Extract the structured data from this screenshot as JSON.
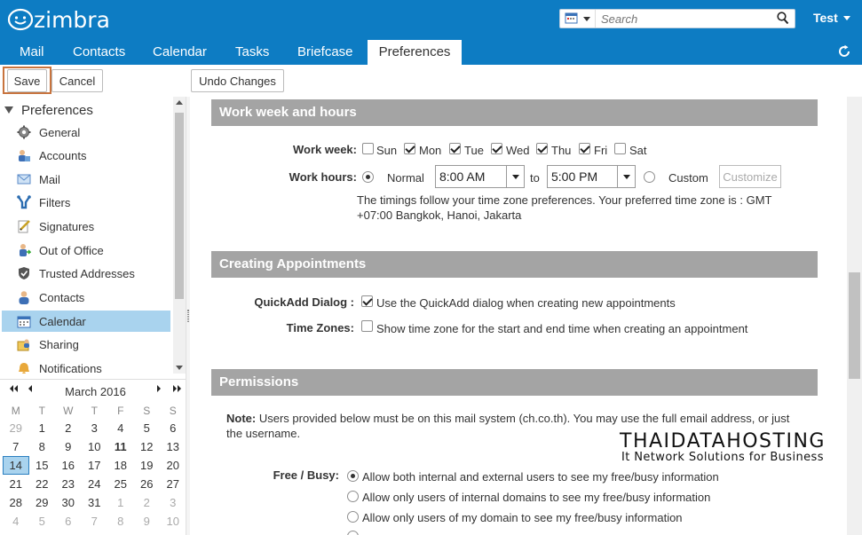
{
  "app": {
    "brand": "zimbra",
    "accent": "#0d7cc3"
  },
  "header": {
    "search_placeholder": "Search",
    "user": "Test"
  },
  "tabs": [
    "Mail",
    "Contacts",
    "Calendar",
    "Tasks",
    "Briefcase",
    "Preferences"
  ],
  "active_tab": "Preferences",
  "toolbar": {
    "save": "Save",
    "cancel": "Cancel",
    "undo": "Undo Changes"
  },
  "sidebar": {
    "title": "Preferences",
    "items": [
      {
        "label": "General",
        "icon": "gear-icon"
      },
      {
        "label": "Accounts",
        "icon": "accounts-icon"
      },
      {
        "label": "Mail",
        "icon": "mail-icon"
      },
      {
        "label": "Filters",
        "icon": "filter-icon"
      },
      {
        "label": "Signatures",
        "icon": "signature-icon"
      },
      {
        "label": "Out of Office",
        "icon": "out-of-office-icon"
      },
      {
        "label": "Trusted Addresses",
        "icon": "shield-icon"
      },
      {
        "label": "Contacts",
        "icon": "contacts-icon"
      },
      {
        "label": "Calendar",
        "icon": "calendar-icon"
      },
      {
        "label": "Sharing",
        "icon": "sharing-icon"
      },
      {
        "label": "Notifications",
        "icon": "notifications-icon"
      }
    ],
    "selected": "Calendar"
  },
  "minical": {
    "month": "March 2016",
    "weekdays": [
      "M",
      "T",
      "W",
      "T",
      "F",
      "S",
      "S"
    ],
    "weeks": [
      [
        "29",
        "1",
        "2",
        "3",
        "4",
        "5",
        "6"
      ],
      [
        "7",
        "8",
        "9",
        "10",
        "11",
        "12",
        "13"
      ],
      [
        "14",
        "15",
        "16",
        "17",
        "18",
        "19",
        "20"
      ],
      [
        "21",
        "22",
        "23",
        "24",
        "25",
        "26",
        "27"
      ],
      [
        "28",
        "29",
        "30",
        "31",
        "1",
        "2",
        "3"
      ],
      [
        "4",
        "5",
        "6",
        "7",
        "8",
        "9",
        "10"
      ]
    ],
    "today": "11",
    "selected": "14"
  },
  "work_week": {
    "section_title": "Work week and hours",
    "week_label": "Work week:",
    "days": [
      {
        "label": "Sun",
        "checked": false
      },
      {
        "label": "Mon",
        "checked": true
      },
      {
        "label": "Tue",
        "checked": true
      },
      {
        "label": "Wed",
        "checked": true
      },
      {
        "label": "Thu",
        "checked": true
      },
      {
        "label": "Fri",
        "checked": true
      },
      {
        "label": "Sat",
        "checked": false
      }
    ],
    "hours_label": "Work hours:",
    "normal_label": "Normal",
    "start": "8:00 AM",
    "to": "to",
    "end": "5:00 PM",
    "custom_label": "Custom",
    "customize_button": "Customize",
    "tz_note_1": "The timings follow your time zone preferences. Your preferred time zone is : GMT",
    "tz_note_2": "+07:00 Bangkok, Hanoi, Jakarta"
  },
  "appointments": {
    "section_title": "Creating Appointments",
    "quickadd_label": "QuickAdd Dialog :",
    "quickadd_text": "Use the QuickAdd dialog when creating new appointments",
    "quickadd_checked": true,
    "timezones_label": "Time Zones:",
    "timezones_text": "Show time zone for the start and end time when creating an appointment",
    "timezones_checked": false
  },
  "permissions": {
    "section_title": "Permissions",
    "note_bold": "Note:",
    "note_text_1": "Users provided below must be on this mail system (ch.co.th). You may use the full email address, or just",
    "note_text_2": "the username.",
    "freebusy_label": "Free / Busy:",
    "options": [
      {
        "label": "Allow both internal and external users to see my free/busy information",
        "selected": true
      },
      {
        "label": "Allow only users of internal domains to see my free/busy information",
        "selected": false
      },
      {
        "label": "Allow only users of my domain to see my free/busy information",
        "selected": false
      }
    ]
  },
  "watermark": {
    "name": "THAIDATAHOSTING",
    "tagline": "It Network Solutions for Business"
  }
}
